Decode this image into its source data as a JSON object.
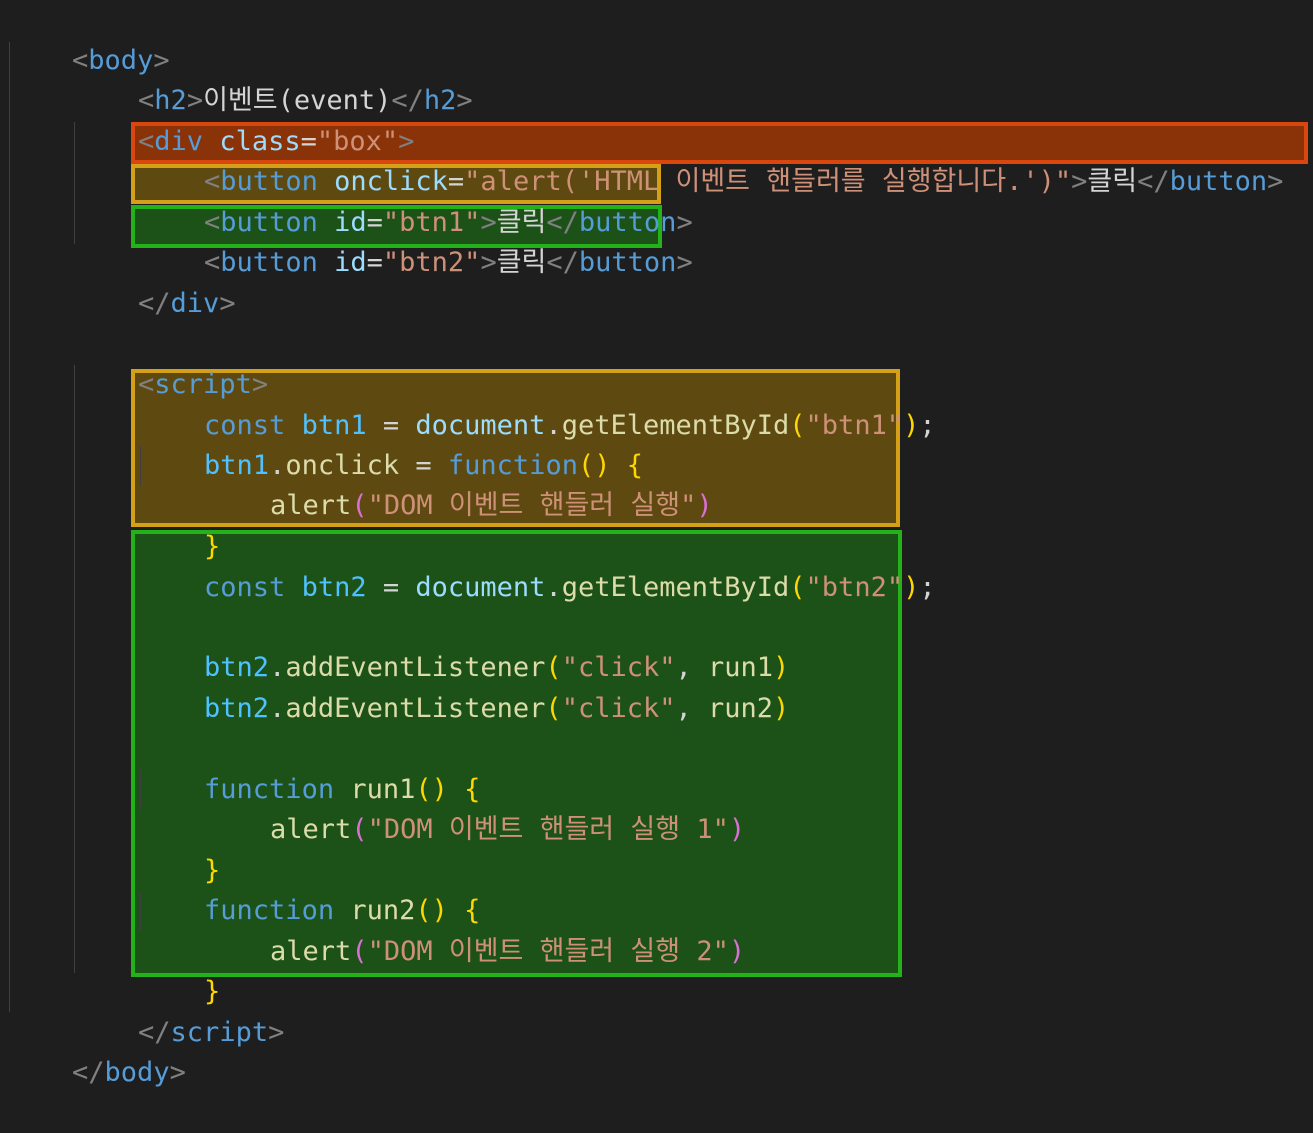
{
  "code": {
    "l01": {
      "tag_open": "<",
      "tag": "body",
      "tag_close": ">"
    },
    "l02": {
      "o1": "<",
      "tag": "h2",
      "c1": ">",
      "text": "이벤트(event)",
      "o2": "</",
      "tag2": "h2",
      "c2": ">"
    },
    "l03": {
      "o1": "<",
      "tag": "div",
      "sp": " ",
      "attr": "class",
      "eq": "=",
      "val": "\"box\"",
      "c1": ">"
    },
    "l04": {
      "o1": "<",
      "tag": "button",
      "sp": " ",
      "attr": "onclick",
      "eq": "=",
      "val": "\"alert('HTML 이벤트 핸들러를 실행합니다.')\"",
      "c1": ">",
      "text": "클릭",
      "o2": "</",
      "tag2": "button",
      "c2": ">"
    },
    "l05": {
      "o1": "<",
      "tag": "button",
      "sp": " ",
      "attr": "id",
      "eq": "=",
      "val": "\"btn1\"",
      "c1": ">",
      "text": "클릭",
      "o2": "</",
      "tag2": "button",
      "c2": ">"
    },
    "l06": {
      "o1": "<",
      "tag": "button",
      "sp": " ",
      "attr": "id",
      "eq": "=",
      "val": "\"btn2\"",
      "c1": ">",
      "text": "클릭",
      "o2": "</",
      "tag2": "button",
      "c2": ">"
    },
    "l07": {
      "o1": "</",
      "tag": "div",
      "c1": ">"
    },
    "l09": {
      "o1": "<",
      "tag": "script",
      "c1": ">"
    },
    "l10": {
      "kw": "const",
      "sp1": " ",
      "var": "btn1",
      "op": " = ",
      "obj": "document",
      "dot": ".",
      "fn": "getElementById",
      "p1": "(",
      "str": "\"btn1\"",
      "p2": ")",
      "semi": ";"
    },
    "l11": {
      "var": "btn1",
      "dot": ".",
      "prop": "onclick",
      "op": " = ",
      "kw": "function",
      "parens": "()",
      "sp": " ",
      "brace": "{"
    },
    "l12": {
      "fn": "alert",
      "p1": "(",
      "str": "\"DOM 이벤트 핸들러 실행\"",
      "p2": ")"
    },
    "l13": {
      "brace": "}"
    },
    "l14": {
      "kw": "const",
      "sp1": " ",
      "var": "btn2",
      "op": " = ",
      "obj": "document",
      "dot": ".",
      "fn": "getElementById",
      "p1": "(",
      "str": "\"btn2\"",
      "p2": ")",
      "semi": ";"
    },
    "l16": {
      "var": "btn2",
      "dot": ".",
      "fn": "addEventListener",
      "p1": "(",
      "str": "\"click\"",
      "comma": ", ",
      "arg": "run1",
      "p2": ")"
    },
    "l17": {
      "var": "btn2",
      "dot": ".",
      "fn": "addEventListener",
      "p1": "(",
      "str": "\"click\"",
      "comma": ", ",
      "arg": "run2",
      "p2": ")"
    },
    "l19": {
      "kw": "function",
      "sp": " ",
      "fn": "run1",
      "parens": "()",
      "sp2": " ",
      "brace": "{"
    },
    "l20": {
      "fn": "alert",
      "p1": "(",
      "str": "\"DOM 이벤트 핸들러 실행 1\"",
      "p2": ")"
    },
    "l21": {
      "brace": "}"
    },
    "l22": {
      "kw": "function",
      "sp": " ",
      "fn": "run2",
      "parens": "()",
      "sp2": " ",
      "brace": "{"
    },
    "l23": {
      "fn": "alert",
      "p1": "(",
      "str": "\"DOM 이벤트 핸들러 실행 2\"",
      "p2": ")"
    },
    "l24": {
      "brace": "}"
    },
    "l25": {
      "o1": "</",
      "tag": "script",
      "c1": ">"
    },
    "l26": {
      "o1": "</",
      "tag": "body",
      "c1": ">"
    }
  },
  "colors": {
    "background": "#1e1e1e",
    "highlight_orange": "#d9470f",
    "highlight_yellow": "#d4a017",
    "highlight_green": "#23b21a"
  }
}
